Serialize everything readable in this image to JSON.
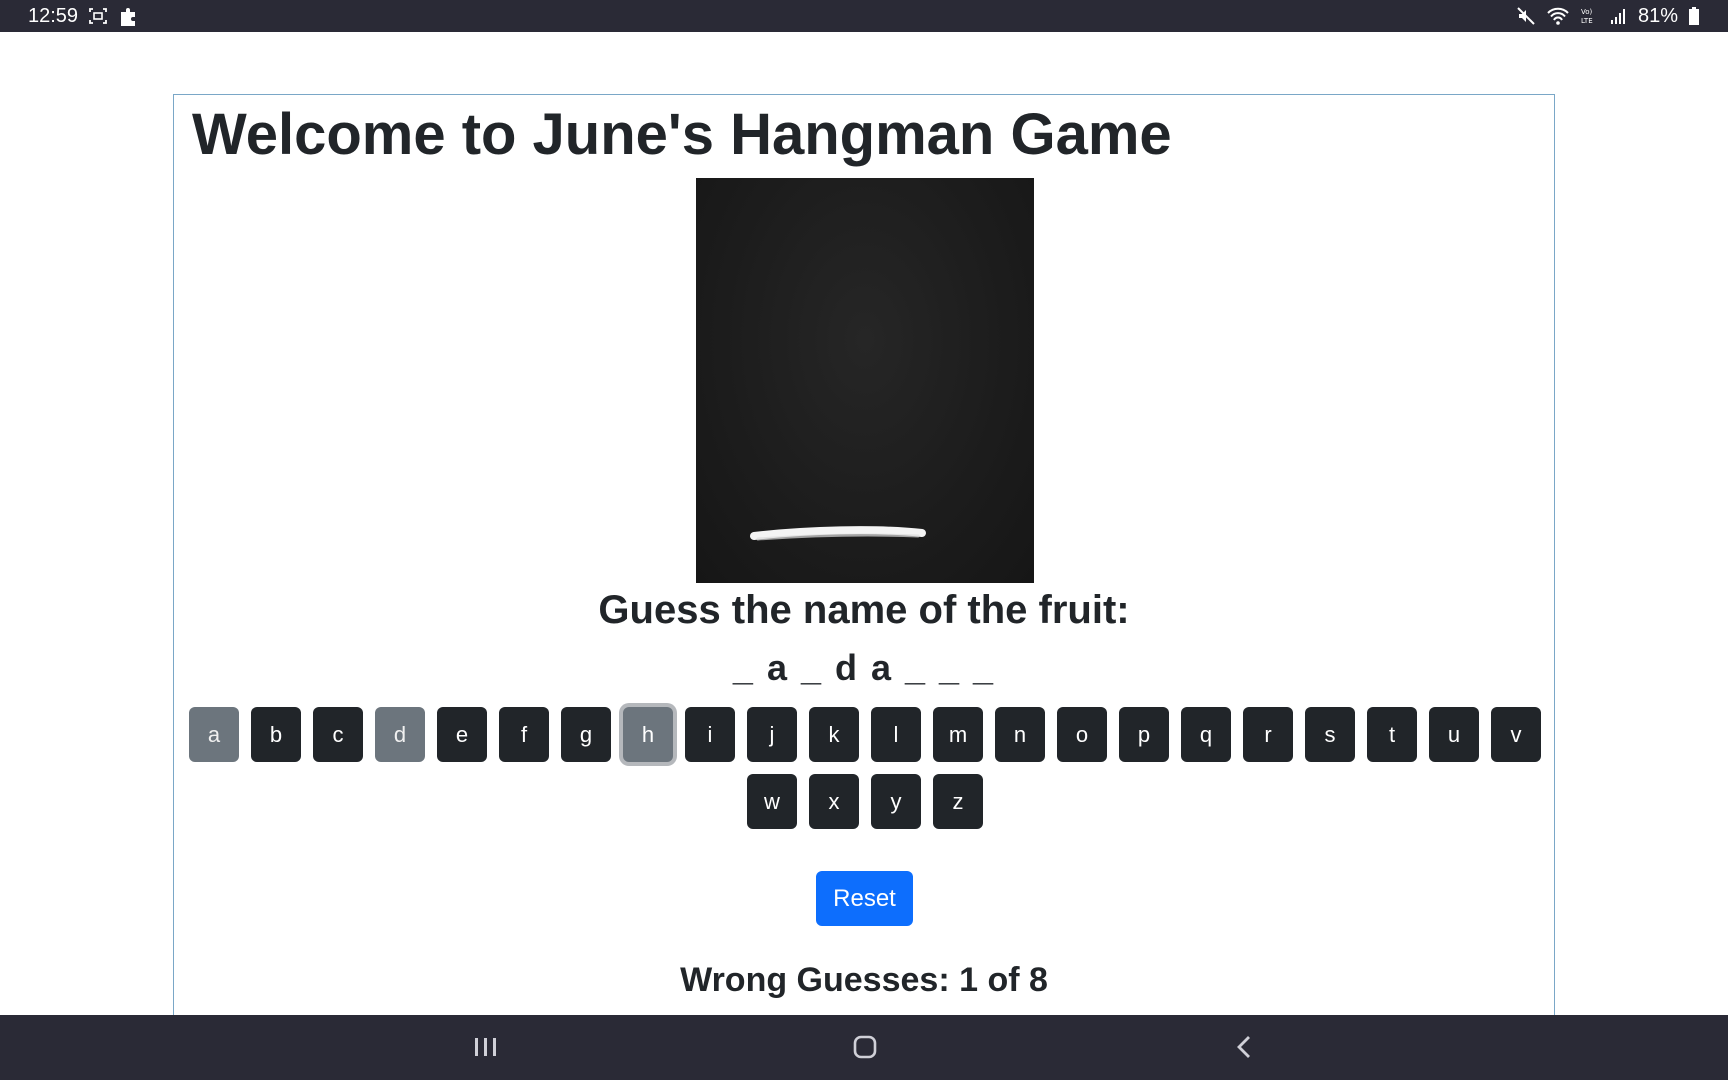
{
  "status_bar": {
    "time": "12:59",
    "left_icons": [
      "screenshot-icon",
      "puzzle-icon"
    ],
    "right_icons": [
      "mute-icon",
      "wifi-icon",
      "volte-icon",
      "signal-icon"
    ],
    "battery_pct": "81%"
  },
  "game": {
    "title": "Welcome to June's Hangman Game",
    "prompt": "Guess the name of the fruit:",
    "word_display": "_ a _ d a _ _ _",
    "keys": [
      {
        "label": "a",
        "state": "used"
      },
      {
        "label": "b",
        "state": "available"
      },
      {
        "label": "c",
        "state": "available"
      },
      {
        "label": "d",
        "state": "used"
      },
      {
        "label": "e",
        "state": "available"
      },
      {
        "label": "f",
        "state": "available"
      },
      {
        "label": "g",
        "state": "available"
      },
      {
        "label": "h",
        "state": "used-focused"
      },
      {
        "label": "i",
        "state": "available"
      },
      {
        "label": "j",
        "state": "available"
      },
      {
        "label": "k",
        "state": "available"
      },
      {
        "label": "l",
        "state": "available"
      },
      {
        "label": "m",
        "state": "available"
      },
      {
        "label": "n",
        "state": "available"
      },
      {
        "label": "o",
        "state": "available"
      },
      {
        "label": "p",
        "state": "available"
      },
      {
        "label": "q",
        "state": "available"
      },
      {
        "label": "r",
        "state": "available"
      },
      {
        "label": "s",
        "state": "available"
      },
      {
        "label": "t",
        "state": "available"
      },
      {
        "label": "u",
        "state": "available"
      },
      {
        "label": "v",
        "state": "available"
      },
      {
        "label": "w",
        "state": "available"
      },
      {
        "label": "x",
        "state": "available"
      },
      {
        "label": "y",
        "state": "available"
      },
      {
        "label": "z",
        "state": "available"
      }
    ],
    "reset_label": "Reset",
    "wrong_guesses": "Wrong Guesses: 1 of 8"
  },
  "nav_bar": {
    "buttons": [
      "recents-icon",
      "home-icon",
      "back-icon"
    ]
  },
  "colors": {
    "key_available": "#212529",
    "key_used": "#6c757d",
    "reset_button": "#0d6efd",
    "system_bars": "#2a2a36"
  }
}
